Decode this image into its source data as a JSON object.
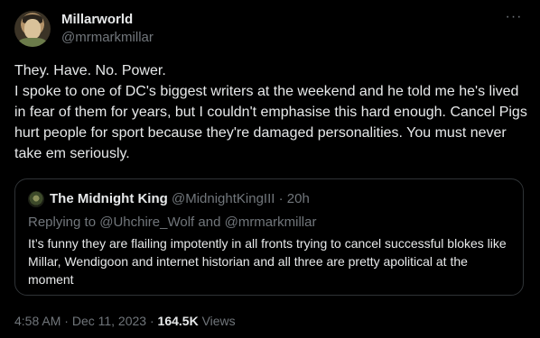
{
  "author": {
    "display_name": "Millarworld",
    "handle": "@mrmarkmillar"
  },
  "more_icon_glyph": "···",
  "tweet": {
    "text": "They. Have. No. Power.\nI spoke to one of DC's biggest writers at the weekend and he told me he's lived in fear of them for years, but I couldn't emphasise this hard enough. Cancel Pigs hurt people for sport because they're damaged personalities. You must never take em seriously."
  },
  "quoted_tweet": {
    "display_name": "The Midnight King",
    "handle": "@MidnightKingIII",
    "separator": "·",
    "time": "20h",
    "replying_prefix": "Replying to ",
    "replying_to_1": "@Uhchire_Wolf",
    "replying_and": " and ",
    "replying_to_2": "@mrmarkmillar",
    "text": "It’s funny they are flailing impotently in all fronts trying to cancel successful blokes like Millar, Wendigoon and internet historian and all three are pretty apolitical at the moment"
  },
  "footer": {
    "time": "4:58 AM",
    "separator_1": "·",
    "date": "Dec 11, 2023",
    "separator_2": "·",
    "views_count": "164.5K",
    "views_label": "Views"
  },
  "colors": {
    "background": "#000000",
    "primary_text": "#e7e9ea",
    "secondary_text": "#71767b",
    "border": "#2f3336"
  }
}
